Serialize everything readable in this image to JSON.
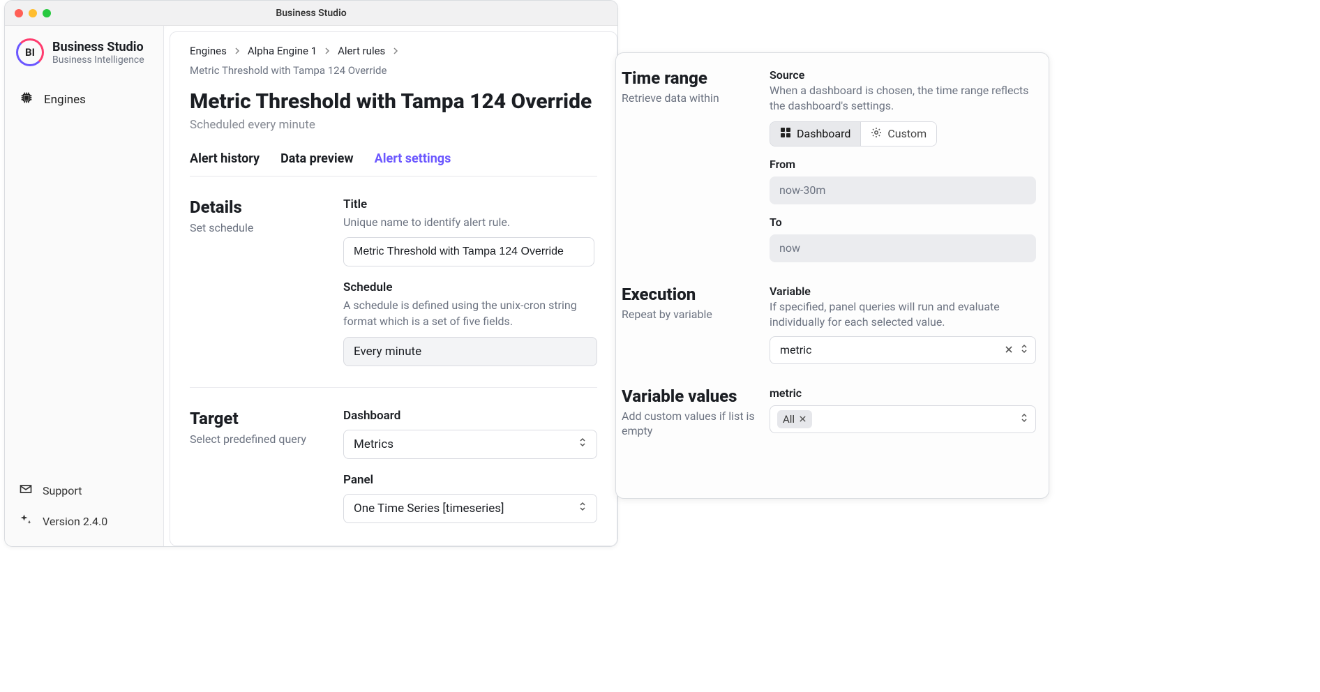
{
  "window": {
    "title": "Business Studio"
  },
  "brand": {
    "name": "Business Studio",
    "sub": "Business Intelligence",
    "logo_text": "BI"
  },
  "sidebar": {
    "items": [
      {
        "label": "Engines"
      }
    ],
    "footer": {
      "support": "Support",
      "version": "Version 2.4.0"
    }
  },
  "breadcrumb": {
    "items": [
      "Engines",
      "Alpha Engine 1",
      "Alert rules",
      "Metric Threshold with Tampa 124 Override"
    ]
  },
  "page": {
    "title": "Metric Threshold with Tampa 124 Override",
    "subtitle": "Scheduled every minute"
  },
  "tabs": [
    {
      "label": "Alert history"
    },
    {
      "label": "Data preview"
    },
    {
      "label": "Alert settings",
      "active": true
    }
  ],
  "details": {
    "section_title": "Details",
    "section_desc": "Set schedule",
    "title_label": "Title",
    "title_desc": "Unique name to identify alert rule.",
    "title_value": "Metric Threshold with Tampa 124 Override",
    "schedule_label": "Schedule",
    "schedule_desc": "A schedule is defined using the unix-cron string format which is a set of five fields.",
    "schedule_value": "Every minute"
  },
  "target": {
    "section_title": "Target",
    "section_desc": "Select predefined query",
    "dashboard_label": "Dashboard",
    "dashboard_value": "Metrics",
    "panel_label": "Panel",
    "panel_value": "One Time Series [timeseries]"
  },
  "time_range": {
    "section_title": "Time range",
    "section_desc": "Retrieve data within",
    "source_label": "Source",
    "source_desc": "When a dashboard is chosen, the time range reflects the dashboard's settings.",
    "source_options": {
      "dashboard": "Dashboard",
      "custom": "Custom"
    },
    "from_label": "From",
    "from_value": "now-30m",
    "to_label": "To",
    "to_value": "now"
  },
  "execution": {
    "section_title": "Execution",
    "section_desc": "Repeat by variable",
    "variable_label": "Variable",
    "variable_desc": "If specified, panel queries will run and evaluate individually for each selected value.",
    "variable_value": "metric"
  },
  "variable_values": {
    "section_title": "Variable values",
    "section_desc": "Add custom values if list is empty",
    "metric_label": "metric",
    "chip": "All"
  }
}
